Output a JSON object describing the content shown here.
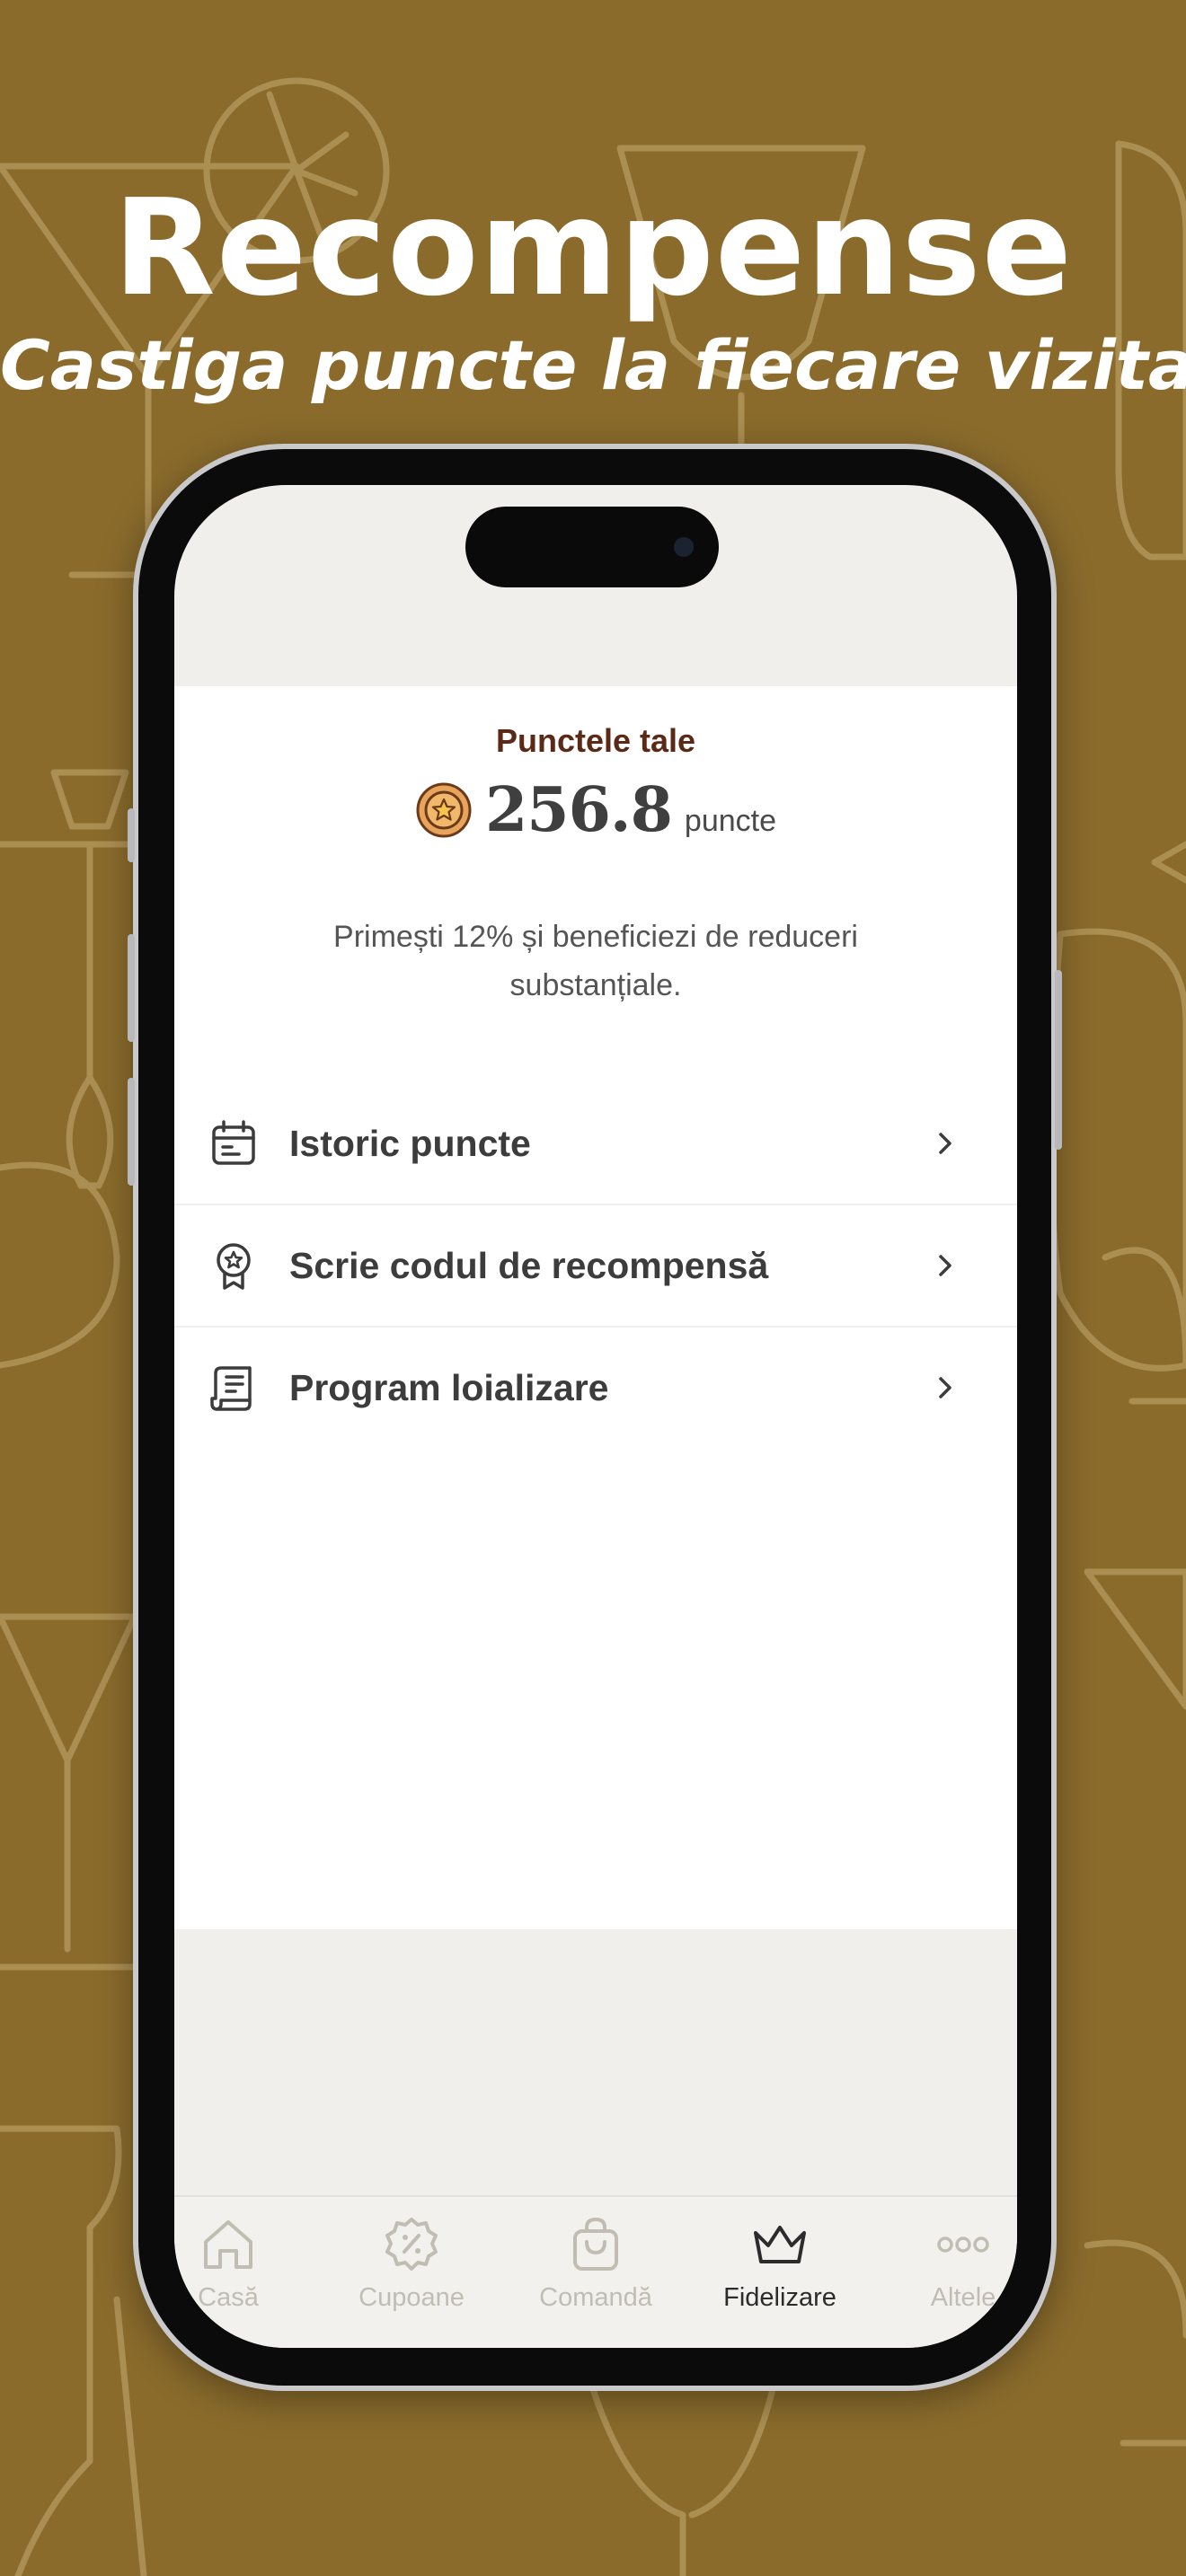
{
  "promo": {
    "title": "Recompense",
    "subtitle": "Castiga puncte la fiecare vizita!"
  },
  "loyalty": {
    "heading": "Punctele tale",
    "points_value": "256.8",
    "points_unit": "puncte",
    "description": "Primești 12% și beneficiezi de reduceri substanțiale.",
    "coin_icon": "star-coin-icon"
  },
  "menu": {
    "items": [
      {
        "label": "Istoric puncte",
        "icon": "calendar-icon"
      },
      {
        "label": "Scrie codul de recompensă",
        "icon": "award-badge-icon"
      },
      {
        "label": "Program loializare",
        "icon": "scroll-document-icon"
      }
    ]
  },
  "tabbar": {
    "tabs": [
      {
        "label": "Casă",
        "icon": "home-icon",
        "active": false
      },
      {
        "label": "Cupoane",
        "icon": "discount-badge-icon",
        "active": false
      },
      {
        "label": "Comandă",
        "icon": "shopping-bag-icon",
        "active": false
      },
      {
        "label": "Fidelizare",
        "icon": "crown-icon",
        "active": true
      },
      {
        "label": "Altele",
        "icon": "more-dots-icon",
        "active": false
      }
    ]
  },
  "colors": {
    "background": "#8a6b2c",
    "heading_brown": "#5a2a17",
    "coin_orange": "#e8a45a",
    "active_tab": "#2c2c2c",
    "inactive_tab": "#c2bdb3"
  }
}
